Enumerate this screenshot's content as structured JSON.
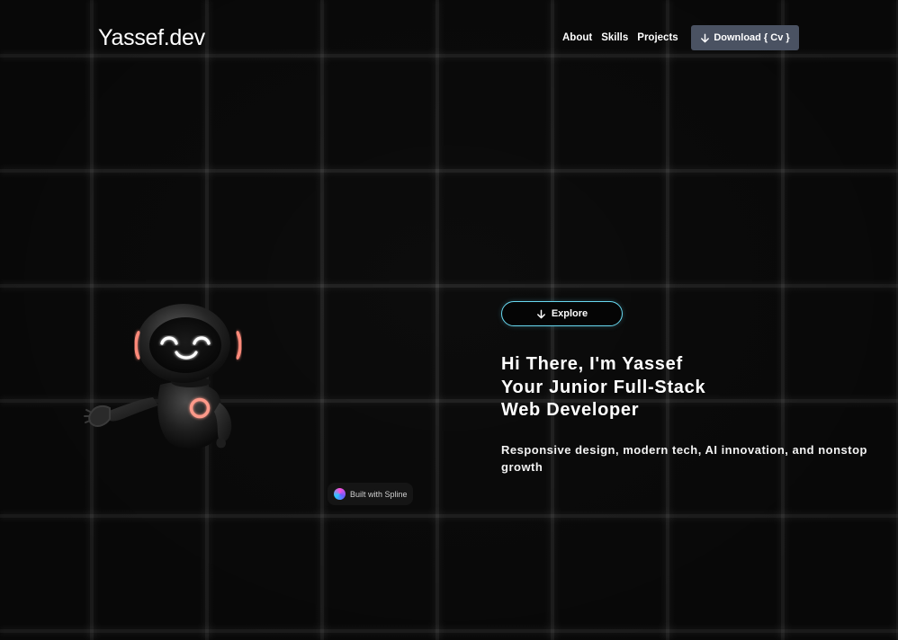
{
  "header": {
    "logo": "Yassef.dev",
    "nav": [
      {
        "label": "About"
      },
      {
        "label": "Skills"
      },
      {
        "label": "Projects"
      }
    ],
    "download_label": "Download { Cv }",
    "download_icon": "arrow-down-icon",
    "download_color": "#4a5262"
  },
  "hero": {
    "explore_label": "Explore",
    "explore_icon": "arrow-down-icon",
    "explore_border_color": "#68d8f0",
    "title_lines": [
      "Hi There, I'm Yassef",
      "Your Junior Full-Stack",
      "Web Developer"
    ],
    "subtitle": "Responsive design, modern tech, AI innovation, and nonstop growth"
  },
  "spline": {
    "badge_label": "Built with Spline"
  },
  "colors": {
    "background": "#0c0c0c",
    "robot_glow": "#ff8a7a"
  }
}
